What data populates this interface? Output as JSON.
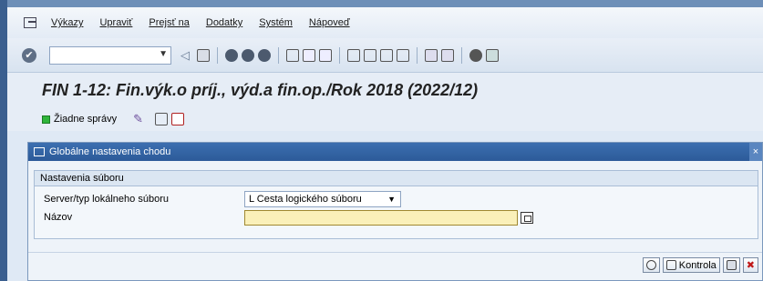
{
  "menu": {
    "items": [
      "Výkazy",
      "Upraviť",
      "Prejsť na",
      "Dodatky",
      "Systém",
      "Nápoveď"
    ]
  },
  "toolbar": {
    "command_value": "",
    "icons": [
      "back-icon",
      "save-icon",
      "nav-back-icon",
      "exit-icon",
      "cancel-icon",
      "print-icon",
      "find-icon",
      "find-next-icon",
      "first-page-icon",
      "prev-page-icon",
      "next-page-icon",
      "last-page-icon",
      "new-session-icon",
      "shortcut-icon",
      "help-icon",
      "layout-icon"
    ]
  },
  "page": {
    "title": "FIN 1-12: Fin.výk.o príj., výd.a fin.op./Rok 2018 (2022/12)"
  },
  "apptoolbar": {
    "no_messages": "Žiadne správy"
  },
  "dialog": {
    "title": "Globálne nastavenia chodu",
    "close": "×",
    "group_title": "Nastavenia súboru",
    "server_label": "Server/typ lokálneho súboru",
    "server_value": "L Cesta logického súboru",
    "name_label": "Názov",
    "name_value": "",
    "check_label": "Kontrola"
  },
  "colors": {
    "title_bar": "#2c5a99",
    "input_required": "#faf0b9",
    "status_green": "#2fb53a"
  }
}
